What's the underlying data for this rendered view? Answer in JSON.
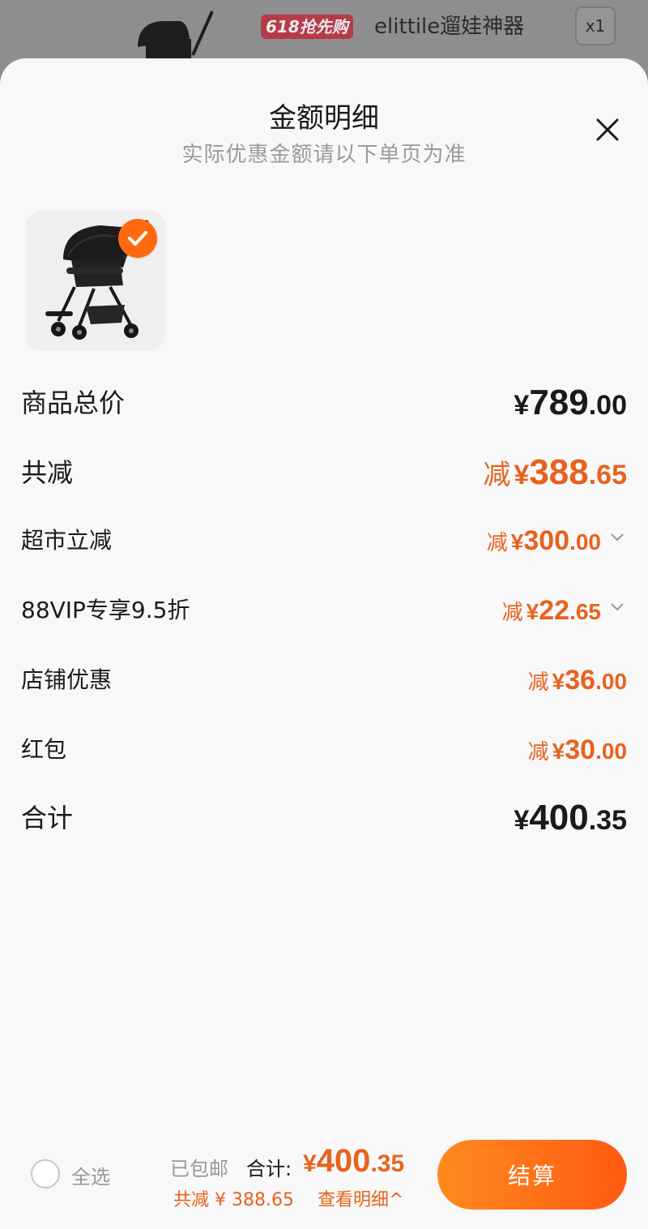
{
  "background": {
    "promo_tag": "618抢先购",
    "product_title": "elittile遛娃神器",
    "quantity": "x1"
  },
  "sheet": {
    "title": "金额明细",
    "subtitle": "实际优惠金额请以下单页为准"
  },
  "rows": {
    "total_price": {
      "label": "商品总价",
      "yen": "¥",
      "int": "789",
      "dec": ".00"
    },
    "total_discount": {
      "label": "共减",
      "prefix": "减",
      "yen": "¥",
      "int": "388",
      "dec": ".65"
    },
    "supermarket": {
      "label": "超市立减",
      "prefix": "减",
      "yen": "¥",
      "int": "300",
      "dec": ".00"
    },
    "vip": {
      "label": "88VIP专享9.5折",
      "prefix": "减",
      "yen": "¥",
      "int": "22",
      "dec": ".65"
    },
    "store": {
      "label": "店铺优惠",
      "prefix": "减",
      "yen": "¥",
      "int": "36",
      "dec": ".00"
    },
    "red_packet": {
      "label": "红包",
      "prefix": "减",
      "yen": "¥",
      "int": "30",
      "dec": ".00"
    },
    "sum": {
      "label": "合计",
      "yen": "¥",
      "int": "400",
      "dec": ".35"
    }
  },
  "bottom": {
    "select_all": "全选",
    "shipping": "已包邮",
    "total_label": "合计:",
    "total_yen": "¥",
    "total_int": "400",
    "total_dec": ".35",
    "discount": "共减 ¥ 388.65",
    "detail_link": "查看明细^",
    "checkout": "结算"
  },
  "colors": {
    "accent": "#e8621e",
    "check_badge": "#ff6a10",
    "checkout_gradient_start": "#ff8a1e",
    "checkout_gradient_end": "#ff5a12"
  },
  "icons": [
    "close-icon",
    "check-icon",
    "chevron-down-icon",
    "stroller-image"
  ]
}
